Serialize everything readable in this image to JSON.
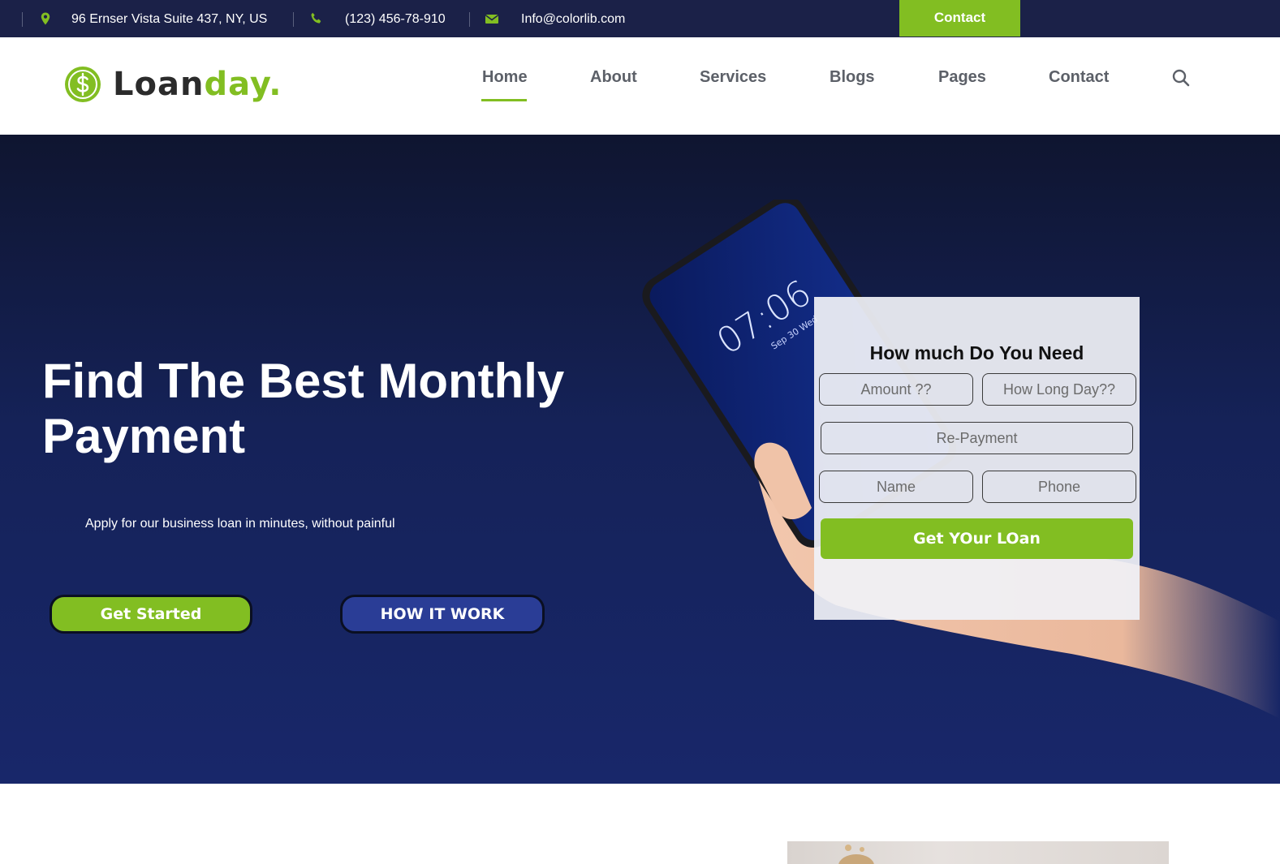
{
  "topbar": {
    "address": "96 Ernser Vista Suite 437, NY, US",
    "phone": "(123) 456-78-910",
    "email": "Info@colorlib.com",
    "contact_label": "Contact",
    "icons": [
      "location-pin-icon",
      "phone-icon",
      "envelope-icon"
    ]
  },
  "header": {
    "logo_part1": "Loan",
    "logo_part2": "day.",
    "logo_icon": "dollar-coin-icon",
    "nav": [
      "Home",
      "About",
      "Services",
      "Blogs",
      "Pages",
      "Contact"
    ],
    "active_nav": "Home",
    "search_icon": "search-icon"
  },
  "hero": {
    "title": "Find The Best Monthly Payment",
    "subtitle": "Apply for our business loan in minutes, without painful",
    "btn_primary": "Get Started",
    "btn_secondary": "HOW IT WORK",
    "phone_time": "07:06",
    "phone_date": "Sep 30  Wed"
  },
  "loan_form": {
    "title": "How much Do You Need",
    "amount_placeholder": "Amount ??",
    "days_placeholder": "How Long Day??",
    "repayment_placeholder": "Re-Payment",
    "name_placeholder": "Name",
    "phone_placeholder": "Phone",
    "submit": "Get YOur LOan"
  },
  "colors": {
    "brand_green": "#82be22",
    "topbar_navy": "#1b2148",
    "hero_navy": "#18276a",
    "secondary_blue": "#2a3d96"
  }
}
